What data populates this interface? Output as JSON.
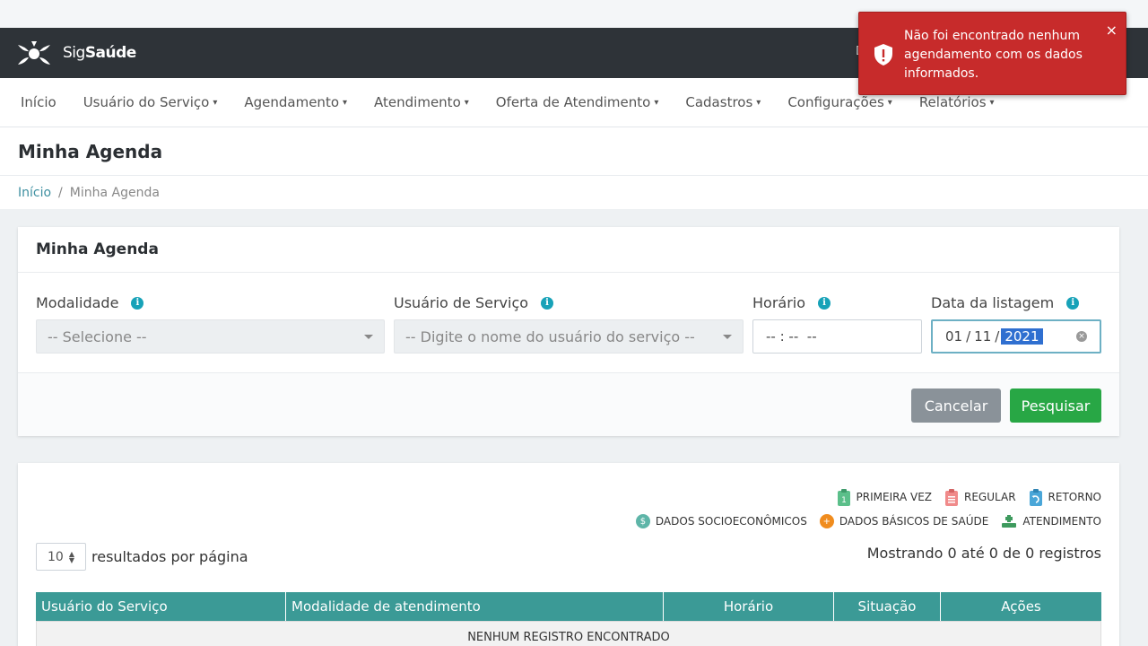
{
  "brand": {
    "name_regular": "Sig",
    "name_bold": "Saúde"
  },
  "header": {
    "partial_text": "D"
  },
  "menu": [
    {
      "label": "Início",
      "has_dropdown": false
    },
    {
      "label": "Usuário do Serviço",
      "has_dropdown": true
    },
    {
      "label": "Agendamento",
      "has_dropdown": true
    },
    {
      "label": "Atendimento",
      "has_dropdown": true
    },
    {
      "label": "Oferta de Atendimento",
      "has_dropdown": true
    },
    {
      "label": "Cadastros",
      "has_dropdown": true
    },
    {
      "label": "Configurações",
      "has_dropdown": true
    },
    {
      "label": "Relatórios",
      "has_dropdown": true
    }
  ],
  "page": {
    "title": "Minha Agenda"
  },
  "breadcrumb": {
    "home": "Início",
    "sep": "/",
    "current": "Minha Agenda"
  },
  "filter_card": {
    "title": "Minha Agenda",
    "modalidade": {
      "label": "Modalidade",
      "value": "-- Selecione --"
    },
    "usuario": {
      "label": "Usuário de Serviço",
      "value": "-- Digite o nome do usuário do serviço --"
    },
    "horario": {
      "label": "Horário",
      "value": "-- : --  --"
    },
    "data": {
      "label": "Data da listagem",
      "day": "01",
      "month": "11",
      "year": "2021"
    },
    "cancel_label": "Cancelar",
    "search_label": "Pesquisar"
  },
  "legend": {
    "primeira_vez": "PRIMEIRA VEZ",
    "regular": "REGULAR",
    "retorno": "RETORNO",
    "socio": "DADOS SOCIOECONÔMICOS",
    "saude": "DADOS BÁSICOS DE SAÚDE",
    "atendimento": "ATENDIMENTO"
  },
  "results": {
    "per_page_value": "10",
    "per_page_label": "resultados por página",
    "showing": "Mostrando 0 até 0 de 0 registros"
  },
  "table": {
    "headers": [
      "Usuário do Serviço",
      "Modalidade de atendimento",
      "Horário",
      "Situação",
      "Ações"
    ],
    "empty": "NENHUM REGISTRO ENCONTRADO"
  },
  "toast": {
    "message": "Não foi encontrado nenhum agendamento com os dados informados.",
    "close": "×"
  },
  "colors": {
    "accent": "#3b9a96",
    "danger": "#c72b2b",
    "success": "#28a745"
  }
}
